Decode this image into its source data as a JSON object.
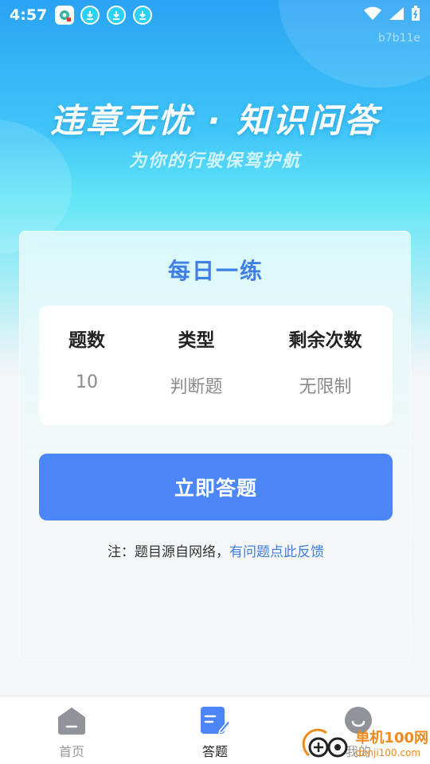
{
  "status_bar": {
    "time": "4:57",
    "code": "b7b11e"
  },
  "hero": {
    "title": "违章无忧 · 知识问答",
    "subtitle": "为你的行驶保驾护航"
  },
  "card": {
    "title": "每日一练",
    "columns": [
      {
        "header": "题数",
        "value": "10"
      },
      {
        "header": "类型",
        "value": "判断题"
      },
      {
        "header": "剩余次数",
        "value": "无限制"
      }
    ],
    "start_button": "立即答题",
    "note_prefix": "注：题目源自网络，",
    "note_link": "有问题点此反馈"
  },
  "tabbar": {
    "items": [
      {
        "label": "首页",
        "icon": "home-icon",
        "active": false
      },
      {
        "label": "答题",
        "icon": "quiz-icon",
        "active": true
      },
      {
        "label": "我的",
        "icon": "profile-icon",
        "active": false
      }
    ]
  },
  "watermark": {
    "cn": "单机100网",
    "en": "danji100.com"
  },
  "colors": {
    "accent": "#4a86f5",
    "title_blue": "#3f7fe6",
    "watermark": "#f08a1c"
  }
}
